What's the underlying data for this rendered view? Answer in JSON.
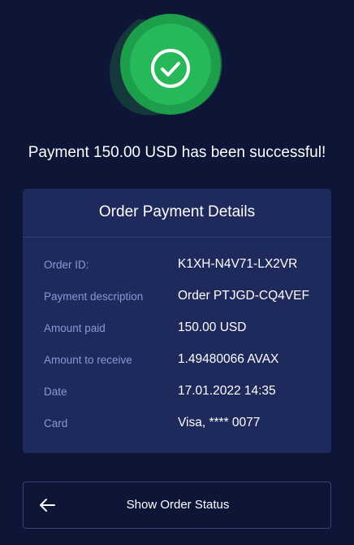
{
  "status": {
    "icon": "check-circle-icon",
    "accent_color": "#1fb04e",
    "headline": "Payment 150.00 USD has been successful!"
  },
  "details": {
    "title": "Order Payment Details",
    "rows": [
      {
        "label": "Order ID:",
        "value": "K1XH-N4V71-LX2VR"
      },
      {
        "label": "Payment description",
        "value": "Order PTJGD-CQ4VEF"
      },
      {
        "label": "Amount paid",
        "value": "150.00 USD"
      },
      {
        "label": "Amount to receive",
        "value": "1.49480066 AVAX"
      },
      {
        "label": "Date",
        "value": "17.01.2022 14:35"
      },
      {
        "label": "Card",
        "value": "Visa, **** 0077"
      }
    ]
  },
  "actions": {
    "show_status_label": "Show Order Status",
    "back_icon": "arrow-left-icon"
  }
}
